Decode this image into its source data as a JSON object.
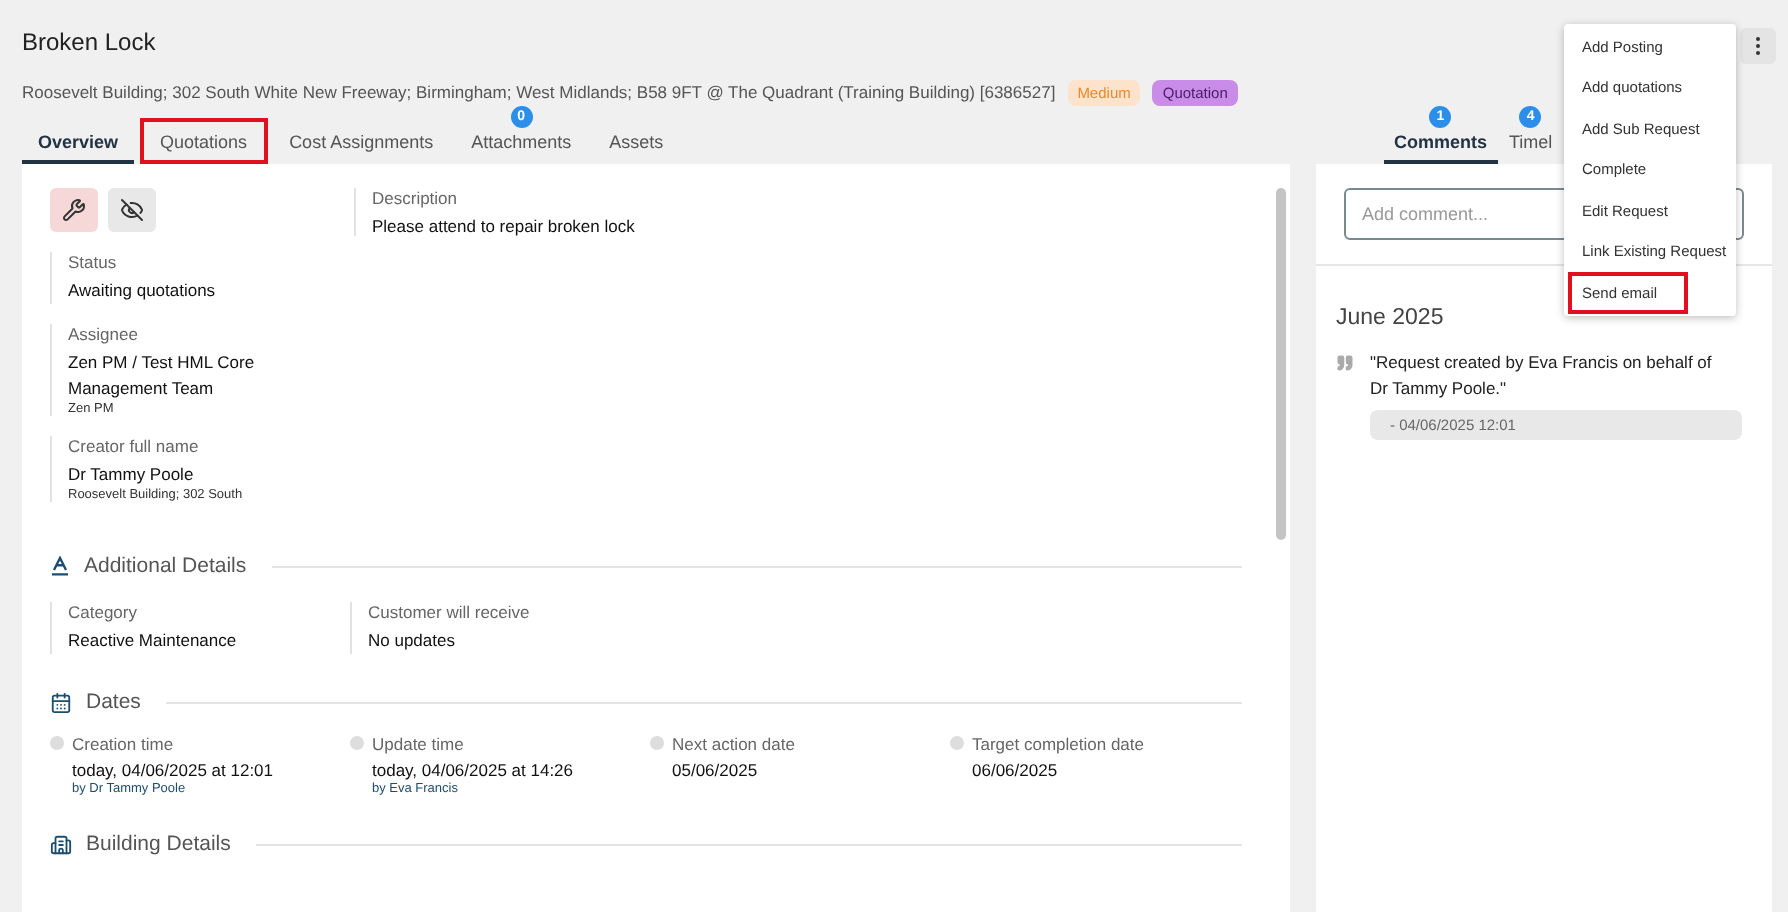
{
  "title": "Broken Lock",
  "address": "Roosevelt Building; 302 South White New Freeway; Birmingham; West Midlands; B58 9FT @ The Quadrant (Training Building) [6386527]",
  "tags": [
    {
      "label": "Medium",
      "color": "#fde3cc"
    },
    {
      "label": "Quotation",
      "color": "#c98ce8"
    }
  ],
  "tabs": [
    {
      "label": "Overview",
      "selected": true,
      "highlighted": false
    },
    {
      "label": "Quotations",
      "selected": false,
      "highlighted": true
    },
    {
      "label": "Cost Assignments",
      "selected": false,
      "highlighted": false
    },
    {
      "label": "Attachments",
      "selected": false,
      "highlighted": false,
      "badge": "0"
    },
    {
      "label": "Assets",
      "selected": false,
      "highlighted": false
    }
  ],
  "overview": {
    "action_icons": [
      {
        "kind": "wrench",
        "active": true
      },
      {
        "kind": "eye-off",
        "active": false
      }
    ],
    "description": {
      "label": "Description",
      "value": "Please attend to repair broken lock"
    },
    "fields": [
      {
        "label": "Status",
        "value": "Awaiting quotations"
      },
      {
        "label": "Assignee",
        "value": "Zen PM / Test HML Core Management Team",
        "sub": "Zen PM"
      },
      {
        "label": "Creator full name",
        "value": "Dr Tammy Poole",
        "sub": "Roosevelt Building; 302 South"
      }
    ]
  },
  "sections": [
    {
      "kind": "details",
      "title": "Additional Details",
      "fields": [
        {
          "label": "Category",
          "value": "Reactive Maintenance"
        },
        {
          "label": "Customer will receive",
          "value": "No updates"
        }
      ]
    },
    {
      "kind": "dates",
      "title": "Dates",
      "dates": [
        {
          "label": "Creation time",
          "value": "today, 04/06/2025 at 12:01",
          "by": "by Dr Tammy Poole"
        },
        {
          "label": "Update time",
          "value": "today, 04/06/2025 at 14:26",
          "by": "by Eva Francis"
        },
        {
          "label": "Next action date",
          "value": "05/06/2025"
        },
        {
          "label": "Target completion date",
          "value": "06/06/2025"
        }
      ]
    },
    {
      "kind": "building",
      "title": "Building Details"
    }
  ],
  "side_tabs": [
    {
      "label": "Comments",
      "badge": "1",
      "selected": true
    },
    {
      "label": "Timel",
      "badge": "4",
      "selected": false
    }
  ],
  "comment": {
    "placeholder": "Add comment..."
  },
  "timeline": {
    "month": "June 2025",
    "entries": [
      {
        "text": "\"Request created by Eva Francis on behalf of Dr Tammy Poole.\"",
        "date": "- 04/06/2025 12:01"
      }
    ]
  },
  "menu": {
    "items": [
      {
        "label": "Add Posting",
        "highlighted": false
      },
      {
        "label": "Add quotations",
        "highlighted": false
      },
      {
        "label": "Add Sub Request",
        "highlighted": false
      },
      {
        "label": "Complete",
        "highlighted": false
      },
      {
        "label": "Edit Request",
        "highlighted": false
      },
      {
        "label": "Link Existing Request",
        "highlighted": false
      },
      {
        "label": "Send email",
        "highlighted": true
      }
    ]
  }
}
